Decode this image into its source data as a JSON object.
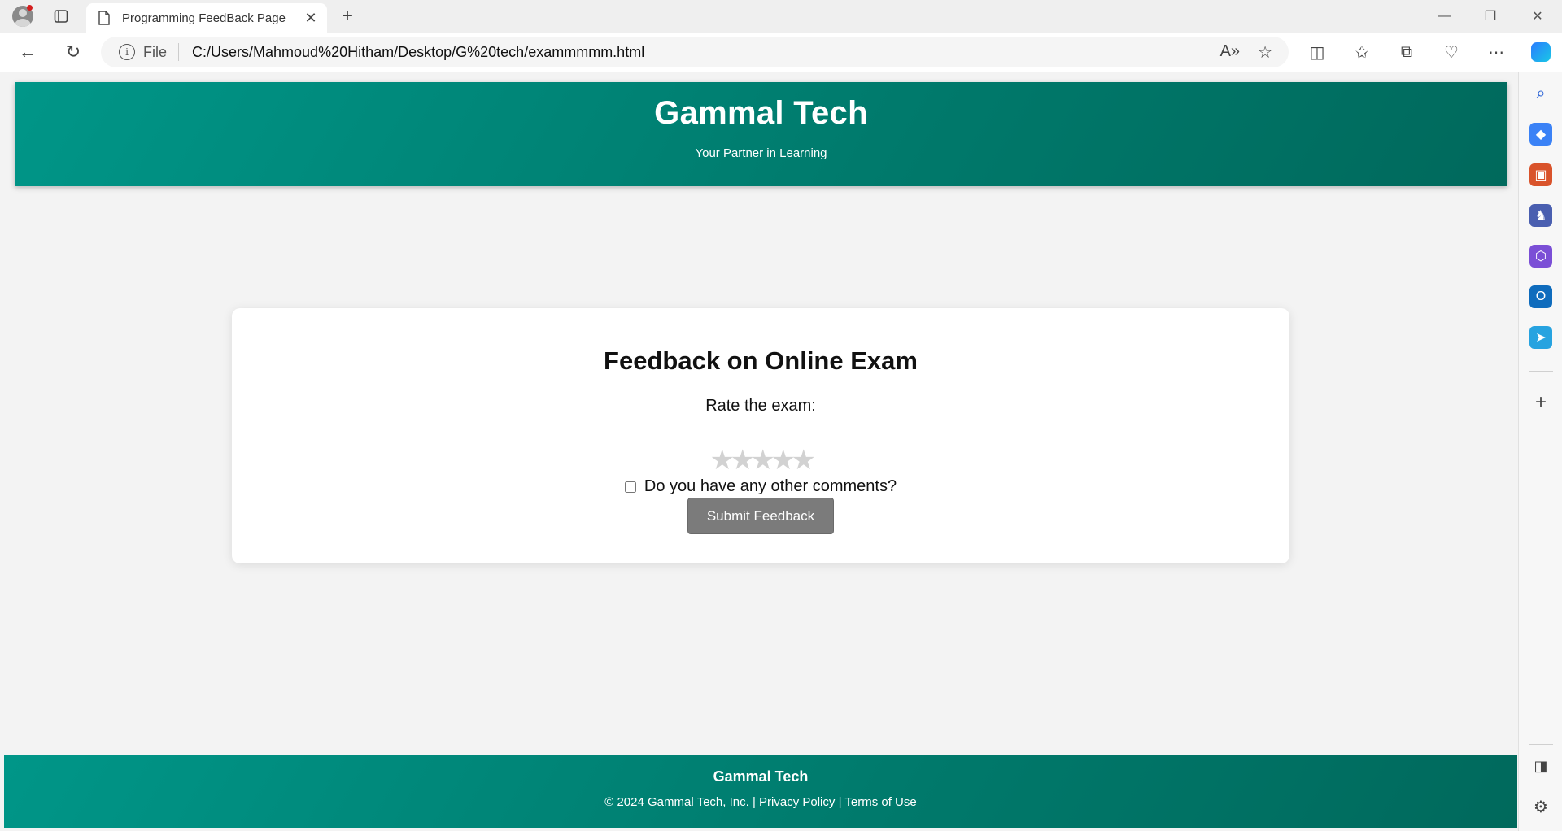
{
  "browser": {
    "tab_title": "Programming FeedBack Page",
    "address_scheme": "File",
    "address_url": "C:/Users/Mahmoud%20Hitham/Desktop/G%20tech/exammmmm.html"
  },
  "header": {
    "title": "Gammal Tech",
    "tagline": "Your Partner in Learning"
  },
  "feedback": {
    "title": "Feedback on Online Exam",
    "rate_label": "Rate the exam:",
    "stars_total": 5,
    "stars_selected": 0,
    "comments_label": "Do you have any other comments?",
    "comments_checked": false,
    "submit_label": "Submit Feedback"
  },
  "footer": {
    "brand": "Gammal Tech",
    "copyright": "© 2024 Gammal Tech, Inc.",
    "separator": "|",
    "privacy": "Privacy Policy",
    "terms": "Terms of Use"
  },
  "colors": {
    "header_start": "#009688",
    "header_end": "#00695c",
    "button": "#7b7b7b",
    "star_empty": "#d2d2d2"
  },
  "icons": [
    "profile-icon",
    "tab-actions-icon",
    "page-icon",
    "close-icon",
    "plus-icon",
    "minimize-icon",
    "restore-icon",
    "window-close-icon",
    "back-icon",
    "refresh-icon",
    "info-icon",
    "read-aloud-icon",
    "favorite-star-icon",
    "split-screen-icon",
    "favorites-icon",
    "collections-icon",
    "browser-essentials-icon",
    "more-icon",
    "copilot-icon",
    "search-icon",
    "shopping-icon",
    "tools-icon",
    "games-icon",
    "microsoft365-icon",
    "outlook-icon",
    "drop-icon",
    "add-icon",
    "sidebar-toggle-icon",
    "settings-icon"
  ]
}
